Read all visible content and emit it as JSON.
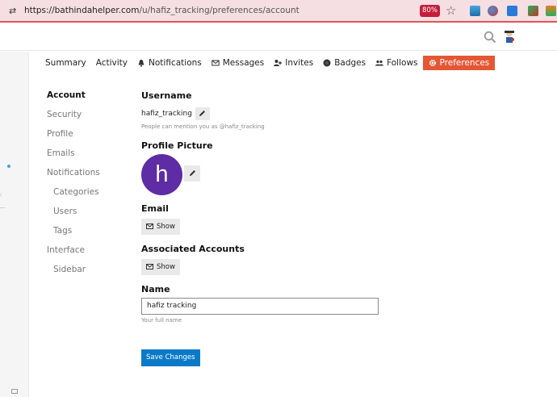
{
  "browser": {
    "url": "https://bathindahelper.com/u/hafiz_tracking/preferences/account",
    "url_host": "https://bathindahelper.com",
    "url_path": "/u/hafiz_tracking/preferences/account",
    "zoom": "80%",
    "accent_color": "#e25656"
  },
  "user_nav": {
    "items": [
      {
        "label": "Summary",
        "icon": ""
      },
      {
        "label": "Activity",
        "icon": ""
      },
      {
        "label": "Notifications",
        "icon": "bell-icon"
      },
      {
        "label": "Messages",
        "icon": "envelope-icon"
      },
      {
        "label": "Invites",
        "icon": "user-plus-icon"
      },
      {
        "label": "Badges",
        "icon": "certificate-icon"
      },
      {
        "label": "Follows",
        "icon": "users-icon"
      },
      {
        "label": "Preferences",
        "icon": "gear-icon"
      }
    ],
    "active_color": "#e45735"
  },
  "prefs_nav": {
    "items": [
      {
        "label": "Account"
      },
      {
        "label": "Security"
      },
      {
        "label": "Profile"
      },
      {
        "label": "Emails"
      },
      {
        "label": "Notifications"
      },
      {
        "label": "Categories"
      },
      {
        "label": "Users"
      },
      {
        "label": "Tags"
      },
      {
        "label": "Interface"
      },
      {
        "label": "Sidebar"
      }
    ]
  },
  "form": {
    "username": {
      "label": "Username",
      "value": "hafiz_tracking",
      "help": "People can mention you as @hafiz_tracking"
    },
    "profile_picture": {
      "label": "Profile Picture",
      "letter": "h",
      "avatar_color": "#5e2ca5"
    },
    "email": {
      "label": "Email",
      "show_label": "Show"
    },
    "associated_accounts": {
      "label": "Associated Accounts",
      "show_label": "Show"
    },
    "name": {
      "label": "Name",
      "value": "hafiz tracking",
      "help": "Your full name"
    },
    "save_label": "Save Changes",
    "save_color": "#0a7ac8"
  }
}
